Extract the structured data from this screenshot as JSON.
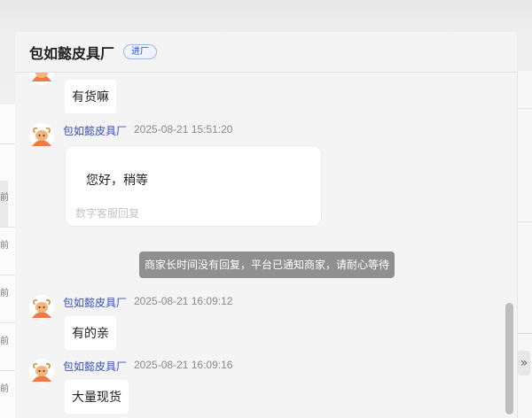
{
  "header": {
    "shop_name": "包如懿皮具厂",
    "badge": "进厂"
  },
  "messages": [
    {
      "type": "partial",
      "text": "有货嘛"
    },
    {
      "type": "card",
      "sender": "包如懿皮具厂",
      "time": "2025-08-21 15:51:20",
      "text": "您好，稍等",
      "note": "数字客服回复"
    },
    {
      "type": "system",
      "text": "商家长时间没有回复，平台已通知商家，请耐心等待"
    },
    {
      "type": "text",
      "sender": "包如懿皮具厂",
      "time": "2025-08-21 16:09:12",
      "text": "有的亲"
    },
    {
      "type": "text",
      "sender": "包如懿皮具厂",
      "time": "2025-08-21 16:09:16",
      "text": "大量现货"
    }
  ],
  "background": {
    "left_ticks": [
      "前",
      "前",
      "前",
      "前",
      "前"
    ],
    "right_collapse_icon": "»"
  },
  "colors": {
    "accent_blue": "#3a4fb0",
    "system_tip_bg": "#8f8f8f",
    "avatar_orange": "#f07a45"
  },
  "icons": {
    "avatar": "cow-mascot-icon",
    "collapse": "double-chevron-right-icon"
  }
}
